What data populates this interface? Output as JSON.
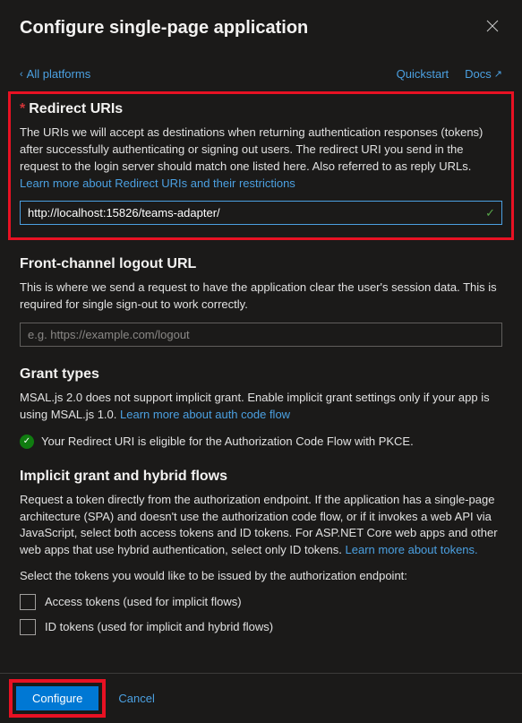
{
  "header": {
    "title": "Configure single-page application"
  },
  "nav": {
    "back": "All platforms",
    "quickstart": "Quickstart",
    "docs": "Docs"
  },
  "redirect": {
    "title": "Redirect URIs",
    "desc": "The URIs we will accept as destinations when returning authentication responses (tokens) after successfully authenticating or signing out users. The redirect URI you send in the request to the login server should match one listed here. Also referred to as reply URLs. ",
    "learn": "Learn more about Redirect URIs and their restrictions",
    "value": "http://localhost:15826/teams-adapter/"
  },
  "frontchannel": {
    "title": "Front-channel logout URL",
    "desc": "This is where we send a request to have the application clear the user's session data. This is required for single sign-out to work correctly.",
    "placeholder": "e.g. https://example.com/logout"
  },
  "grant": {
    "title": "Grant types",
    "desc": "MSAL.js 2.0 does not support implicit grant. Enable implicit grant settings only if your app is using MSAL.js 1.0. ",
    "learn": "Learn more about auth code flow",
    "status": "Your Redirect URI is eligible for the Authorization Code Flow with PKCE."
  },
  "implicit": {
    "title": "Implicit grant and hybrid flows",
    "desc": "Request a token directly from the authorization endpoint. If the application has a single-page architecture (SPA) and doesn't use the authorization code flow, or if it invokes a web API via JavaScript, select both access tokens and ID tokens. For ASP.NET Core web apps and other web apps that use hybrid authentication, select only ID tokens. ",
    "learn": "Learn more about tokens.",
    "select_desc": "Select the tokens you would like to be issued by the authorization endpoint:",
    "access_tokens": "Access tokens (used for implicit flows)",
    "id_tokens": "ID tokens (used for implicit and hybrid flows)"
  },
  "footer": {
    "configure": "Configure",
    "cancel": "Cancel"
  }
}
